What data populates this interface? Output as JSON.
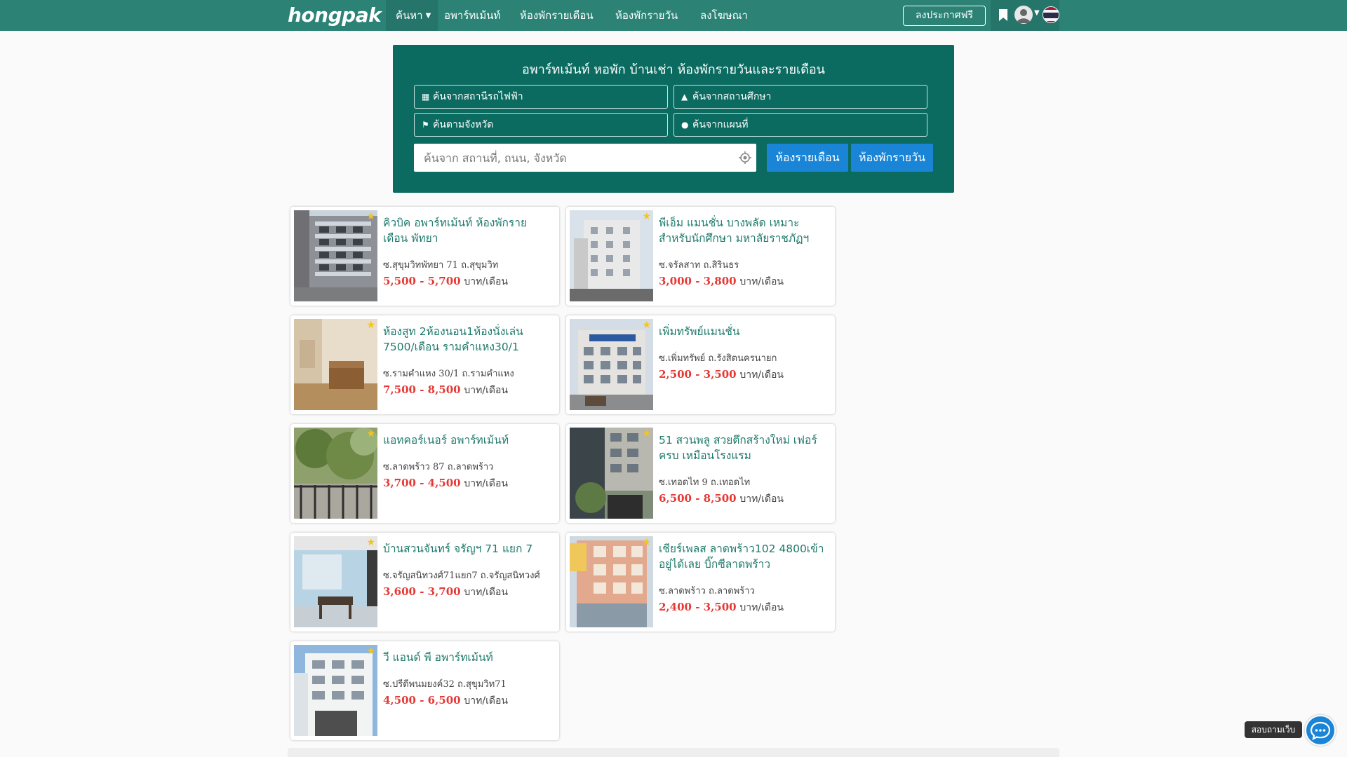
{
  "nav": {
    "logo": "hongpak",
    "search_label": "ค้นหา",
    "links": [
      "อพาร์ทเม้นท์",
      "ห้องพักรายเดือน",
      "ห้องพักรายวัน",
      "ลงโฆษณา"
    ],
    "post_free": "ลงประกาศฟรี"
  },
  "search": {
    "title": "อพาร์ทเม้นท์ หอพัก บ้านเช่า ห้องพักรายวันและรายเดือน",
    "by_station": "ค้นจากสถานีรถไฟฟ้า",
    "by_school": "ค้นจากสถานศึกษา",
    "by_province": "ค้นตามจังหวัด",
    "by_map": "ค้นจากแผนที่",
    "placeholder": "ค้นจาก สถานที่, ถนน, จังหวัด",
    "monthly_button": "ห้องรายเดือน",
    "daily_button": "ห้องพักรายวัน"
  },
  "listings": [
    {
      "title": "คิวบิค อพาร์ทเม้นท์ ห้องพักรายเดือน พัทยา",
      "address": "ซ.สุขุมวิทพัทยา 71 ถ.สุขุมวิท",
      "price": "5,500 - 5,700",
      "unit": "บาท/เดือน",
      "featured": true
    },
    {
      "title": "พีเอ็ม แมนชั่น บางพลัด เหมาะสำหรับนักศึกษา มหาลัยราชภัฏฯ",
      "address": "ซ.จรัลสาท ถ.สิรินธร",
      "price": "3,000 - 3,800",
      "unit": "บาท/เดือน",
      "featured": true
    },
    {
      "title": "ห้องสูท 2ห้องนอน1ห้องนั่งเล่น 7500/เดือน รามคำแหง30/1",
      "address": "ซ.รามคำแหง 30/1 ถ.รามคำแหง",
      "price": "7,500 - 8,500",
      "unit": "บาท/เดือน",
      "featured": true
    },
    {
      "title": "เพิ่มทรัพย์แมนชั่น",
      "address": "ซ.เพิ่มทรัพย์ ถ.รังสิตนครนายก",
      "price": "2,500 - 3,500",
      "unit": "บาท/เดือน",
      "featured": true
    },
    {
      "title": "แอทคอร์เนอร์ อพาร์ทเม้นท์",
      "address": "ซ.ลาดพร้าว 87 ถ.ลาดพร้าว",
      "price": "3,700 - 4,500",
      "unit": "บาท/เดือน",
      "featured": true
    },
    {
      "title": "51 สวนพลู สวยตึกสร้างใหม่ เฟอร์ครบ เหมือนโรงแรม",
      "address": "ซ.เทอดไท 9 ถ.เทอดไท",
      "price": "6,500 - 8,500",
      "unit": "บาท/เดือน",
      "featured": true
    },
    {
      "title": "บ้านสวนจันทร์ จรัญฯ 71 แยก 7",
      "address": "ซ.จรัญสนิทวงศ์71แยก7 ถ.จรัญสนิทวงศ์",
      "price": "3,600 - 3,700",
      "unit": "บาท/เดือน",
      "featured": true
    },
    {
      "title": "เชียร์เพลส ลาดพร้าว102 4800เข้าอยู่ได้เลย บิ๊กซีลาดพร้าว",
      "address": "ซ.ลาดพร้าว ถ.ลาดพร้าว",
      "price": "2,400 - 3,500",
      "unit": "บาท/เดือน",
      "featured": true
    },
    {
      "title": "วี แอนด์ พี อพาร์ทเม้นท์",
      "address": "ซ.ปรีดีพนมยงค์32 ถ.สุขุมวิท71",
      "price": "4,500 - 6,500",
      "unit": "บาท/เดือน",
      "featured": true
    }
  ],
  "chat": {
    "label": "สอบถามเว็บ"
  },
  "colors": {
    "navbar": "#2b8275",
    "panel": "#0b6b60",
    "button": "#1a85d6",
    "price": "#e53935",
    "title": "#1f7a6c"
  }
}
